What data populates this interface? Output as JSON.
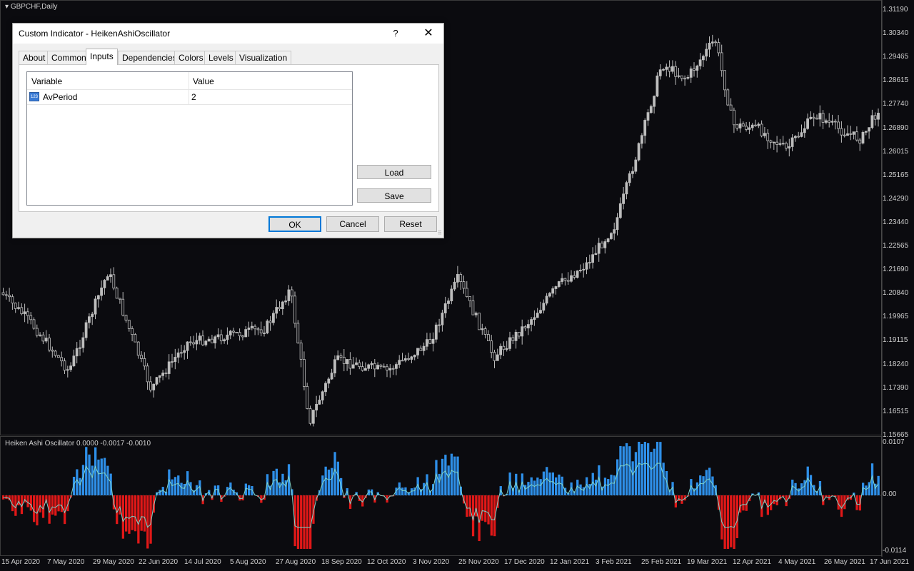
{
  "chart": {
    "symbol_label": "GBPCHF,Daily",
    "indicator_label": "Heiken Ashi Oscillator 0.0000 -0.0017 -0.0010",
    "price_ticks": [
      "1.31190",
      "1.30340",
      "1.29465",
      "1.28615",
      "1.27740",
      "1.26890",
      "1.26015",
      "1.25165",
      "1.24290",
      "1.23440",
      "1.22565",
      "1.21690",
      "1.20840",
      "1.19965",
      "1.19115",
      "1.18240",
      "1.17390",
      "1.16515",
      "1.15665"
    ],
    "osc_ticks": [
      "0.0107",
      "0.00",
      "-0.0114"
    ],
    "date_ticks": [
      "15 Apr 2020",
      "7 May 2020",
      "29 May 2020",
      "22 Jun 2020",
      "14 Jul 2020",
      "5 Aug 2020",
      "27 Aug 2020",
      "18 Sep 2020",
      "12 Oct 2020",
      "3 Nov 2020",
      "25 Nov 2020",
      "17 Dec 2020",
      "12 Jan 2021",
      "3 Feb 2021",
      "25 Feb 2021",
      "19 Mar 2021",
      "12 Apr 2021",
      "4 May 2021",
      "26 May 2021",
      "17 Jun 2021"
    ],
    "colors": {
      "background": "#0b0b0f",
      "candle": "#bdbdbd",
      "osc_positive": "#2e8fe8",
      "osc_negative": "#e01818",
      "signal": "#7fd4c8"
    }
  },
  "dialog": {
    "title": "Custom Indicator - HeikenAshiOscillator",
    "help": "?",
    "close": "✕",
    "tabs": [
      "About",
      "Common",
      "Inputs",
      "Dependencies",
      "Colors",
      "Levels",
      "Visualization"
    ],
    "active_tab": "Inputs",
    "table": {
      "col_variable": "Variable",
      "col_value": "Value",
      "rows": [
        {
          "icon": "123",
          "name": "AvPeriod",
          "value": "2"
        }
      ]
    },
    "buttons": {
      "load": "Load",
      "save": "Save",
      "ok": "OK",
      "cancel": "Cancel",
      "reset": "Reset"
    }
  }
}
